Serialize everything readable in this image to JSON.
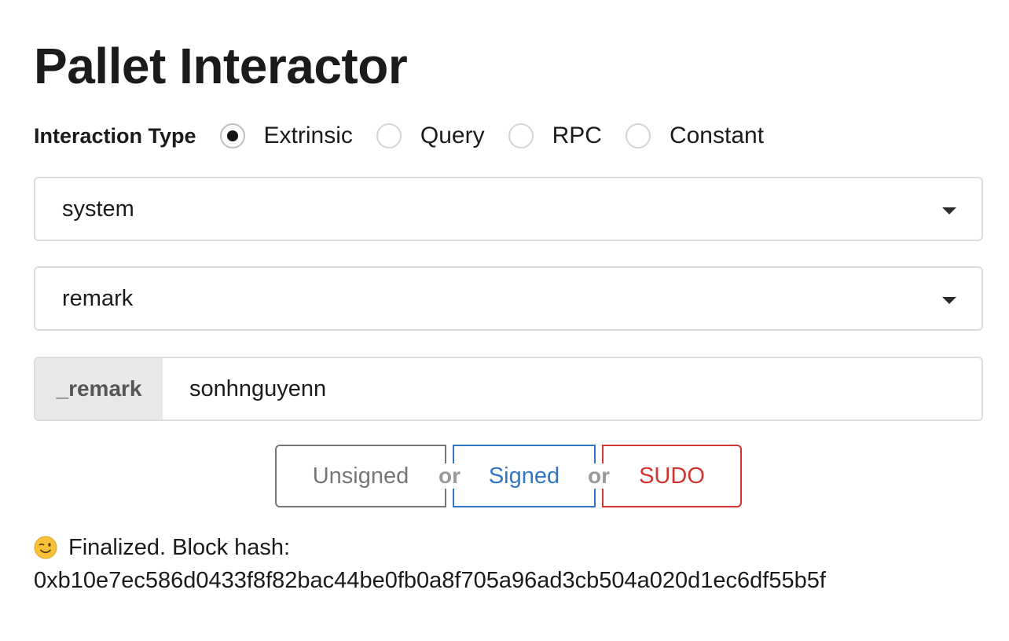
{
  "page": {
    "title": "Pallet Interactor"
  },
  "interaction_type": {
    "label": "Interaction Type",
    "options": [
      {
        "label": "Extrinsic",
        "selected": true
      },
      {
        "label": "Query",
        "selected": false
      },
      {
        "label": "RPC",
        "selected": false
      },
      {
        "label": "Constant",
        "selected": false
      }
    ]
  },
  "pallet_select": {
    "value": "system",
    "icon": "caret-down-icon"
  },
  "call_select": {
    "value": "remark",
    "icon": "caret-down-icon"
  },
  "param": {
    "label": "_remark",
    "value": "sonhnguyenn"
  },
  "buttons": {
    "unsigned": "Unsigned",
    "or1": "or",
    "signed": "Signed",
    "or2": "or",
    "sudo": "SUDO"
  },
  "status": {
    "icon": "wink-emoji-icon",
    "line1": "Finalized. Block hash:",
    "line2": "0xb10e7ec586d0433f8f82bac44be0fb0a8f705a96ad3cb504a020d1ec6df55b5f"
  },
  "colors": {
    "signed": "#2f77c4",
    "sudo": "#d13531",
    "unsigned": "#767676"
  }
}
